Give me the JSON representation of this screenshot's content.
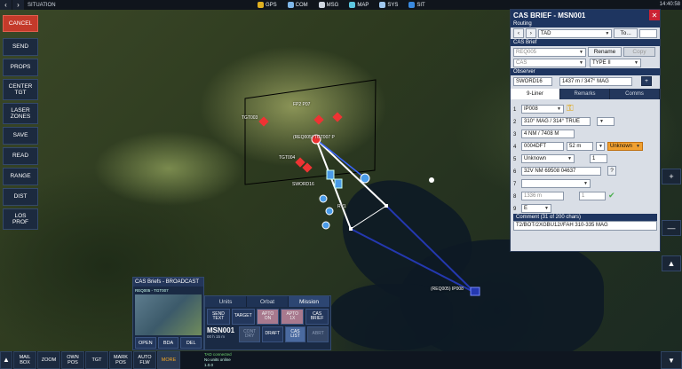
{
  "topbar": {
    "title": "SITUATION",
    "items": [
      "GPS",
      "COM",
      "MSG",
      "MAP",
      "SYS",
      "SIT"
    ],
    "clock": "14:40:58"
  },
  "sidebar": [
    "CANCEL",
    "SEND",
    "PROPS",
    "CENTER\nTGT",
    "LASER\nZONES",
    "SAVE",
    "READ",
    "RANGE",
    "DIST",
    "LOS\nPROF"
  ],
  "bottombar": {
    "buttons": [
      "MAIL\nBOX",
      "ZOOM",
      "OWN\nPOS",
      "TGT",
      "MARK\nPOS",
      "AUTO\nFLW",
      "MORE"
    ],
    "status": [
      "TAD connected",
      "No units online",
      "1.0.0"
    ]
  },
  "map_labels": {
    "tgt03": "TGT003",
    "tgt04": "TGT004",
    "req": "(REQ005) TGT007 P",
    "sword": "SWORD16",
    "ip": "(REQ005) IP008",
    "cp": "FP2 P07",
    "rv": "RV1"
  },
  "cas": {
    "title": "CAS BRIEF - MSN001",
    "routing_label": "Routing",
    "routing_value": "TAD",
    "to_label": "To...",
    "brief_label": "CAS Brief",
    "brief_name": "REQ005",
    "rename": "Rename",
    "copy": "Copy",
    "type_label": "CAS",
    "type_value": "TYPE II",
    "observer_label": "Observer",
    "observer_name": "SWORD16",
    "observer_range": "1437 m / 347° MAG",
    "tabs": [
      "9-Liner",
      "Remarks",
      "Comms"
    ],
    "lines": {
      "l1": "IP008",
      "l2": "310° MAG / 314° TRUE",
      "l3": "4 NM / 7408 M",
      "l4a": "0004DFT",
      "l4b": "52 m",
      "l4c": "Unknown",
      "l5a": "Unknown",
      "l5b": "1",
      "l6": "32V NM 69508 04637",
      "l8": "1336 m",
      "l8b": "1",
      "l9": "E"
    },
    "comment_label": "Comment (31 of 200 chars)",
    "comment": "T2/BOT/2XGBU12//FAH 310-335 MAG"
  },
  "broadcast": {
    "title": "CAS Briefs - BROADCAST",
    "row": "REQ005 - TGT007",
    "buttons": [
      "OPEN",
      "BDA",
      "DEL"
    ]
  },
  "mission": {
    "tabs": [
      "Units",
      "Orbat",
      "Mission"
    ],
    "row1": [
      "SEND\nTEXT",
      "TARGET",
      "APTO\nON",
      "APTO\n1X",
      "CAS\nBRIEF"
    ],
    "name": "MSN001",
    "sub": "00 h 15 m",
    "row2": [
      "CONT\nDRY",
      "DRAFT",
      "CAS\nLIST",
      "ABRT"
    ]
  }
}
